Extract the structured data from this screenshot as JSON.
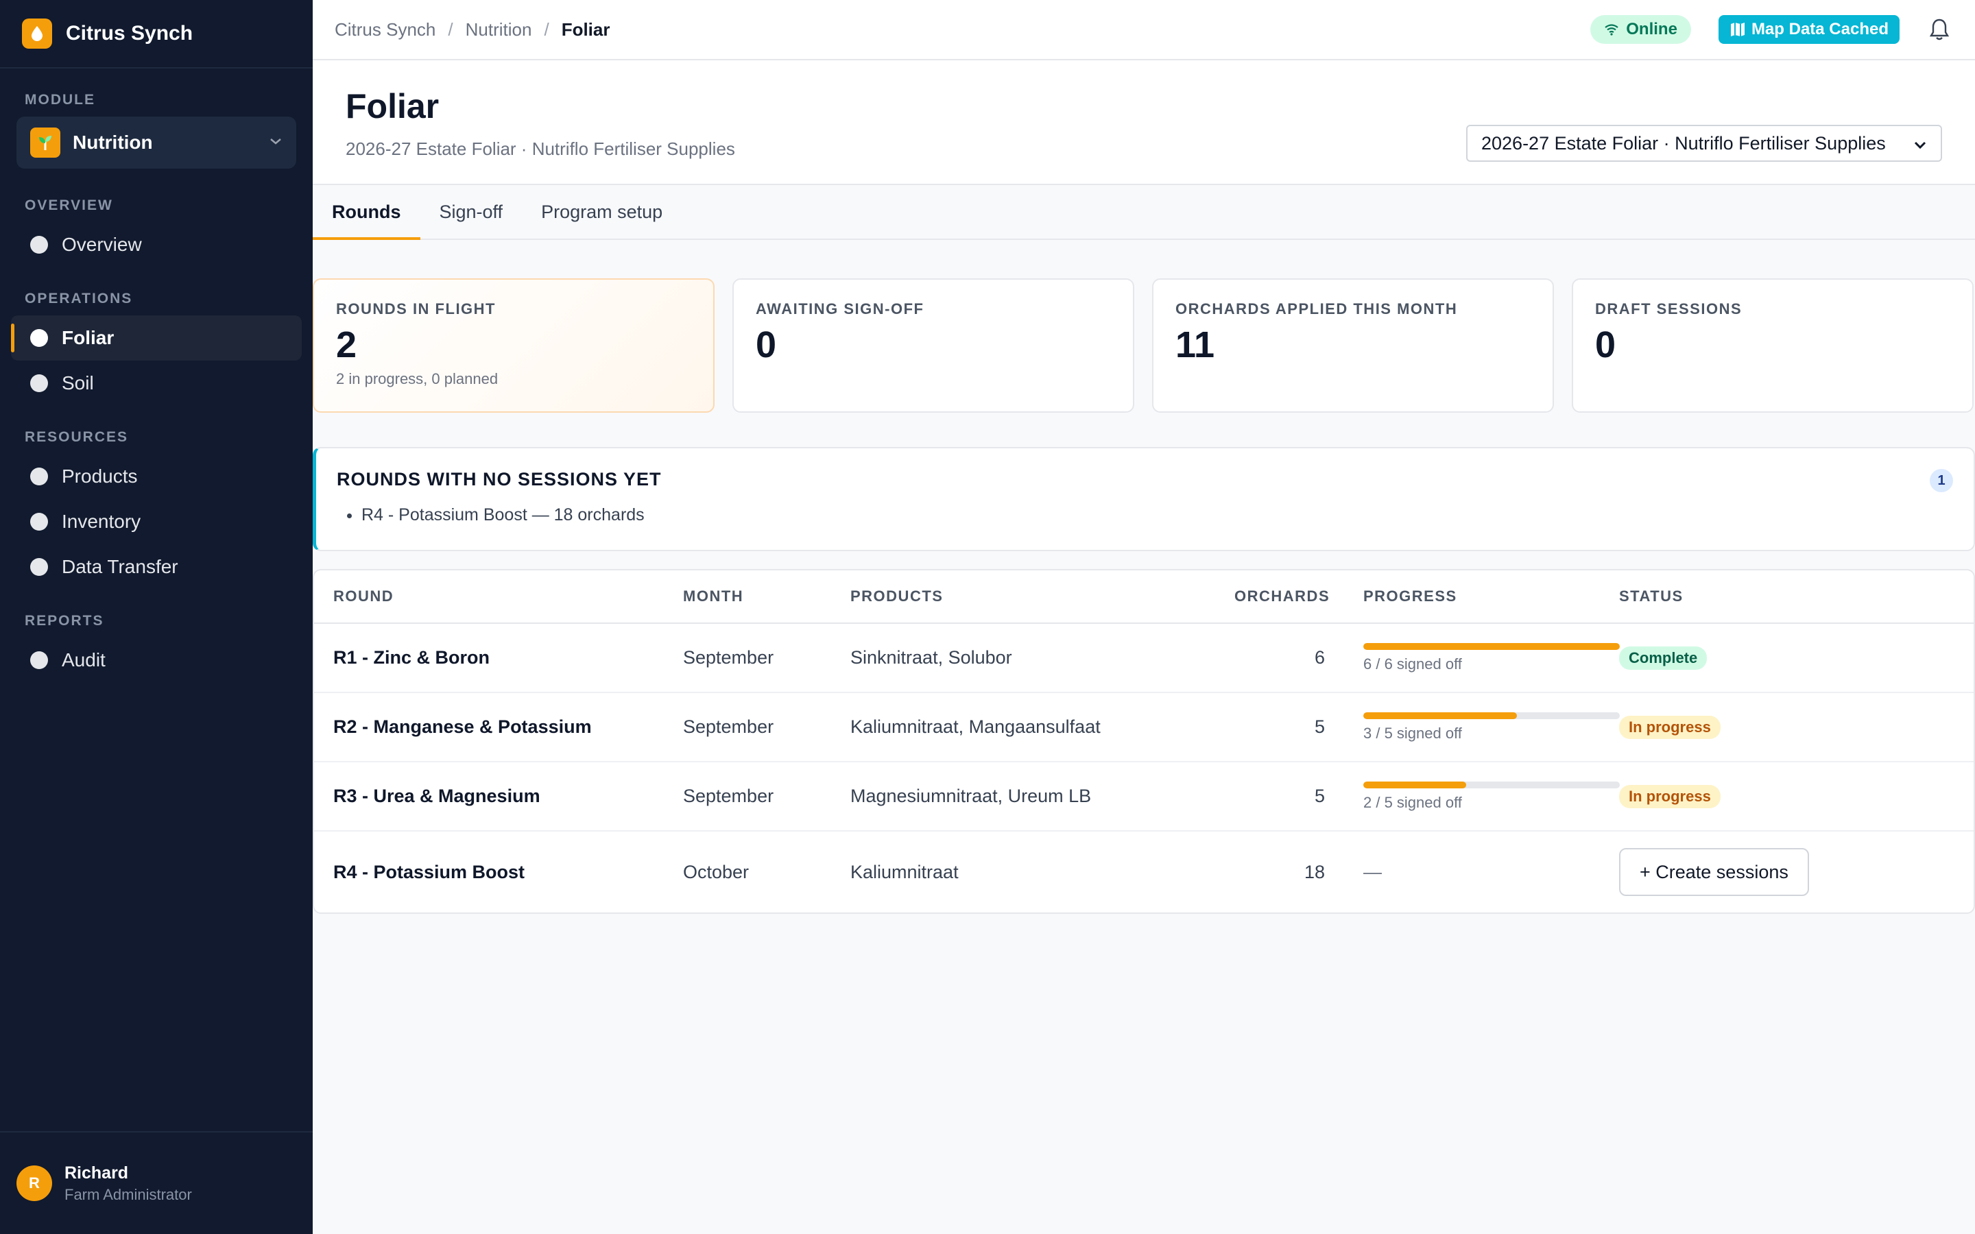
{
  "app": {
    "name": "Citrus Synch"
  },
  "sidebar": {
    "module_label": "MODULE",
    "module_value": "Nutrition",
    "sections": [
      {
        "label": "OVERVIEW",
        "items": [
          "Overview"
        ]
      },
      {
        "label": "OPERATIONS",
        "items": [
          "Foliar",
          "Soil"
        ]
      },
      {
        "label": "RESOURCES",
        "items": [
          "Products",
          "Inventory",
          "Data Transfer"
        ]
      },
      {
        "label": "REPORTS",
        "items": [
          "Audit"
        ]
      }
    ],
    "active_item": "Foliar",
    "user": {
      "initial": "R",
      "name": "Richard",
      "role": "Farm Administrator"
    }
  },
  "topbar": {
    "breadcrumb": [
      "Citrus Synch",
      "Nutrition",
      "Foliar"
    ],
    "online_label": "Online",
    "map_label": "Map Data Cached"
  },
  "page": {
    "title": "Foliar",
    "subtitle": "2026-27 Estate Foliar · Nutriflo Fertiliser Supplies",
    "program_select": "2026-27 Estate Foliar · Nutriflo Fertiliser Supplies"
  },
  "tabs": [
    "Rounds",
    "Sign-off",
    "Program setup"
  ],
  "cards": [
    {
      "label": "ROUNDS IN FLIGHT",
      "value": "2",
      "note": "2 in progress, 0 planned"
    },
    {
      "label": "AWAITING SIGN-OFF",
      "value": "0",
      "note": ""
    },
    {
      "label": "ORCHARDS APPLIED THIS MONTH",
      "value": "11",
      "note": ""
    },
    {
      "label": "DRAFT SESSIONS",
      "value": "0",
      "note": ""
    }
  ],
  "alert": {
    "title": "ROUNDS WITH NO SESSIONS YET",
    "count": "1",
    "items": [
      "R4 - Potassium Boost — 18 orchards"
    ]
  },
  "table": {
    "headers": [
      "ROUND",
      "MONTH",
      "PRODUCTS",
      "ORCHARDS",
      "PROGRESS",
      "STATUS"
    ],
    "rows": [
      {
        "round": "R1 - Zinc & Boron",
        "month": "September",
        "products": "Sinknitraat, Solubor",
        "orchards": "6",
        "progress": 1.0,
        "progress_text": "6 / 6 signed off",
        "status": "Complete"
      },
      {
        "round": "R2 - Manganese & Potassium",
        "month": "September",
        "products": "Kaliumnitraat, Mangaansulfaat",
        "orchards": "5",
        "progress": 0.6,
        "progress_text": "3 / 5 signed off",
        "status": "In progress"
      },
      {
        "round": "R3 - Urea & Magnesium",
        "month": "September",
        "products": "Magnesiumnitraat, Ureum LB",
        "orchards": "5",
        "progress": 0.4,
        "progress_text": "2 / 5 signed off",
        "status": "In progress"
      },
      {
        "round": "R4 - Potassium Boost",
        "month": "October",
        "products": "Kaliumnitraat",
        "orchards": "18",
        "progress_text": "—",
        "action": "+ Create sessions"
      }
    ]
  }
}
